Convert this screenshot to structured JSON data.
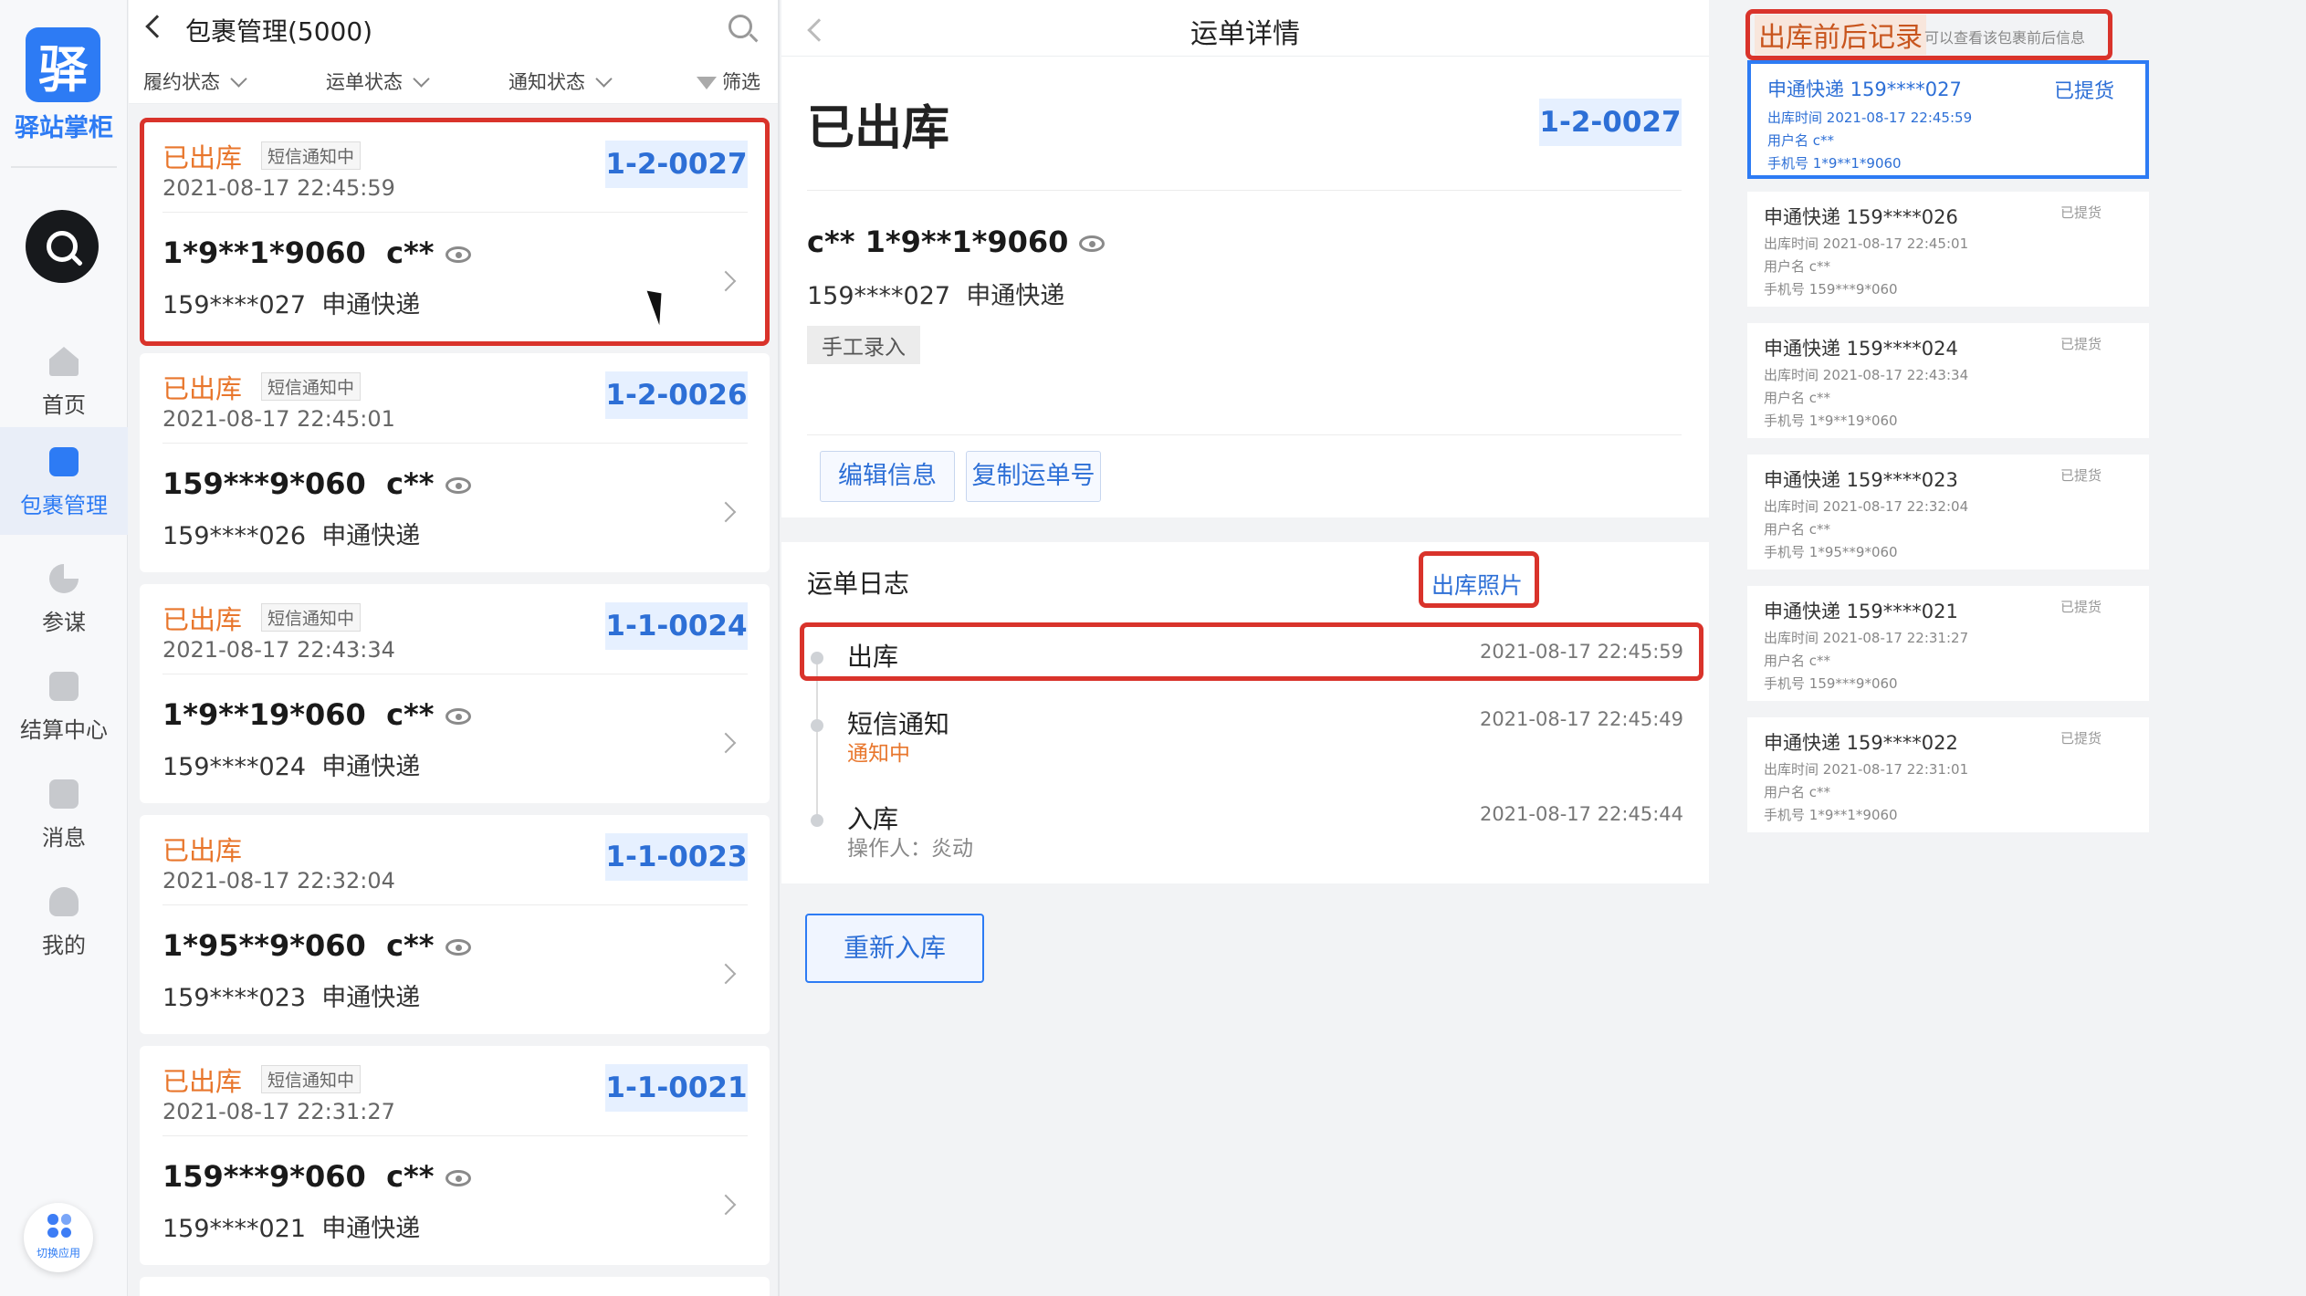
{
  "sidebar": {
    "logo_char": "驿",
    "app_name": "驿站掌柜",
    "nav": [
      {
        "label": "首页",
        "icon": "home-icon"
      },
      {
        "label": "包裹管理",
        "icon": "package-icon"
      },
      {
        "label": "参谋",
        "icon": "chart-icon"
      },
      {
        "label": "结算中心",
        "icon": "settlement-icon"
      },
      {
        "label": "消息",
        "icon": "message-icon"
      },
      {
        "label": "我的",
        "icon": "user-icon"
      }
    ],
    "active_nav": "包裹管理",
    "switch_app_label": "切换应用"
  },
  "list": {
    "title": "包裹管理(5000)",
    "filters": [
      "履约状态",
      "运单状态",
      "通知状态"
    ],
    "filter_button": "筛选",
    "items": [
      {
        "status": "已出库",
        "badge": "短信通知中",
        "time": "2021-08-17 22:45:59",
        "shelf": "1-2-0027",
        "phone": "1*9**1*9060",
        "name": "c**",
        "tracking": "159****027",
        "carrier": "申通快递"
      },
      {
        "status": "已出库",
        "badge": "短信通知中",
        "time": "2021-08-17 22:45:01",
        "shelf": "1-2-0026",
        "phone": "159***9*060",
        "name": "c**",
        "tracking": "159****026",
        "carrier": "申通快递"
      },
      {
        "status": "已出库",
        "badge": "短信通知中",
        "time": "2021-08-17 22:43:34",
        "shelf": "1-1-0024",
        "phone": "1*9**19*060",
        "name": "c**",
        "tracking": "159****024",
        "carrier": "申通快递"
      },
      {
        "status": "已出库",
        "badge": "",
        "time": "2021-08-17 22:32:04",
        "shelf": "1-1-0023",
        "phone": "1*95**9*060",
        "name": "c**",
        "tracking": "159****023",
        "carrier": "申通快递"
      },
      {
        "status": "已出库",
        "badge": "短信通知中",
        "time": "2021-08-17 22:31:27",
        "shelf": "1-1-0021",
        "phone": "159***9*060",
        "name": "c**",
        "tracking": "159****021",
        "carrier": "申通快递"
      }
    ]
  },
  "detail": {
    "header_title": "运单详情",
    "status": "已出库",
    "shelf": "1-2-0027",
    "name_phone": "c** 1*9**1*9060",
    "tracking": "159****027",
    "carrier": "申通快递",
    "entry_tag": "手工录入",
    "edit_button": "编辑信息",
    "copy_button": "复制运单号",
    "log_title": "运单日志",
    "photo_link": "出库照片",
    "logs": [
      {
        "event": "出库",
        "sub": "",
        "time": "2021-08-17 22:45:59"
      },
      {
        "event": "短信通知",
        "sub": "通知中",
        "time": "2021-08-17 22:45:49"
      },
      {
        "event": "入库",
        "sub": "操作人：炎动",
        "time": "2021-08-17 22:45:44"
      }
    ],
    "restock_button": "重新入库"
  },
  "records": {
    "title": "出库前后记录",
    "hint": "可以查看该包裹前后信息",
    "time_label": "出库时间",
    "user_label": "用户名",
    "phone_label": "手机号",
    "items": [
      {
        "name": "申通快递 159****027",
        "status": "已提货",
        "time": "2021-08-17 22:45:59",
        "user": "c**",
        "phone": "1*9**1*9060"
      },
      {
        "name": "申通快递 159****026",
        "status": "已提货",
        "time": "2021-08-17 22:45:01",
        "user": "c**",
        "phone": "159***9*060"
      },
      {
        "name": "申通快递 159****024",
        "status": "已提货",
        "time": "2021-08-17 22:43:34",
        "user": "c**",
        "phone": "1*9**19*060"
      },
      {
        "name": "申通快递 159****023",
        "status": "已提货",
        "time": "2021-08-17 22:32:04",
        "user": "c**",
        "phone": "1*95**9*060"
      },
      {
        "name": "申通快递 159****021",
        "status": "已提货",
        "time": "2021-08-17 22:31:27",
        "user": "c**",
        "phone": "159***9*060"
      },
      {
        "name": "申通快递 159****022",
        "status": "已提货",
        "time": "2021-08-17 22:31:01",
        "user": "c**",
        "phone": "1*9**1*9060"
      }
    ]
  },
  "colors": {
    "accent": "#2d7bf4",
    "shelf_bg": "#e6f0ff",
    "status_orange": "#e8762c",
    "highlight_red": "#d9332b"
  }
}
